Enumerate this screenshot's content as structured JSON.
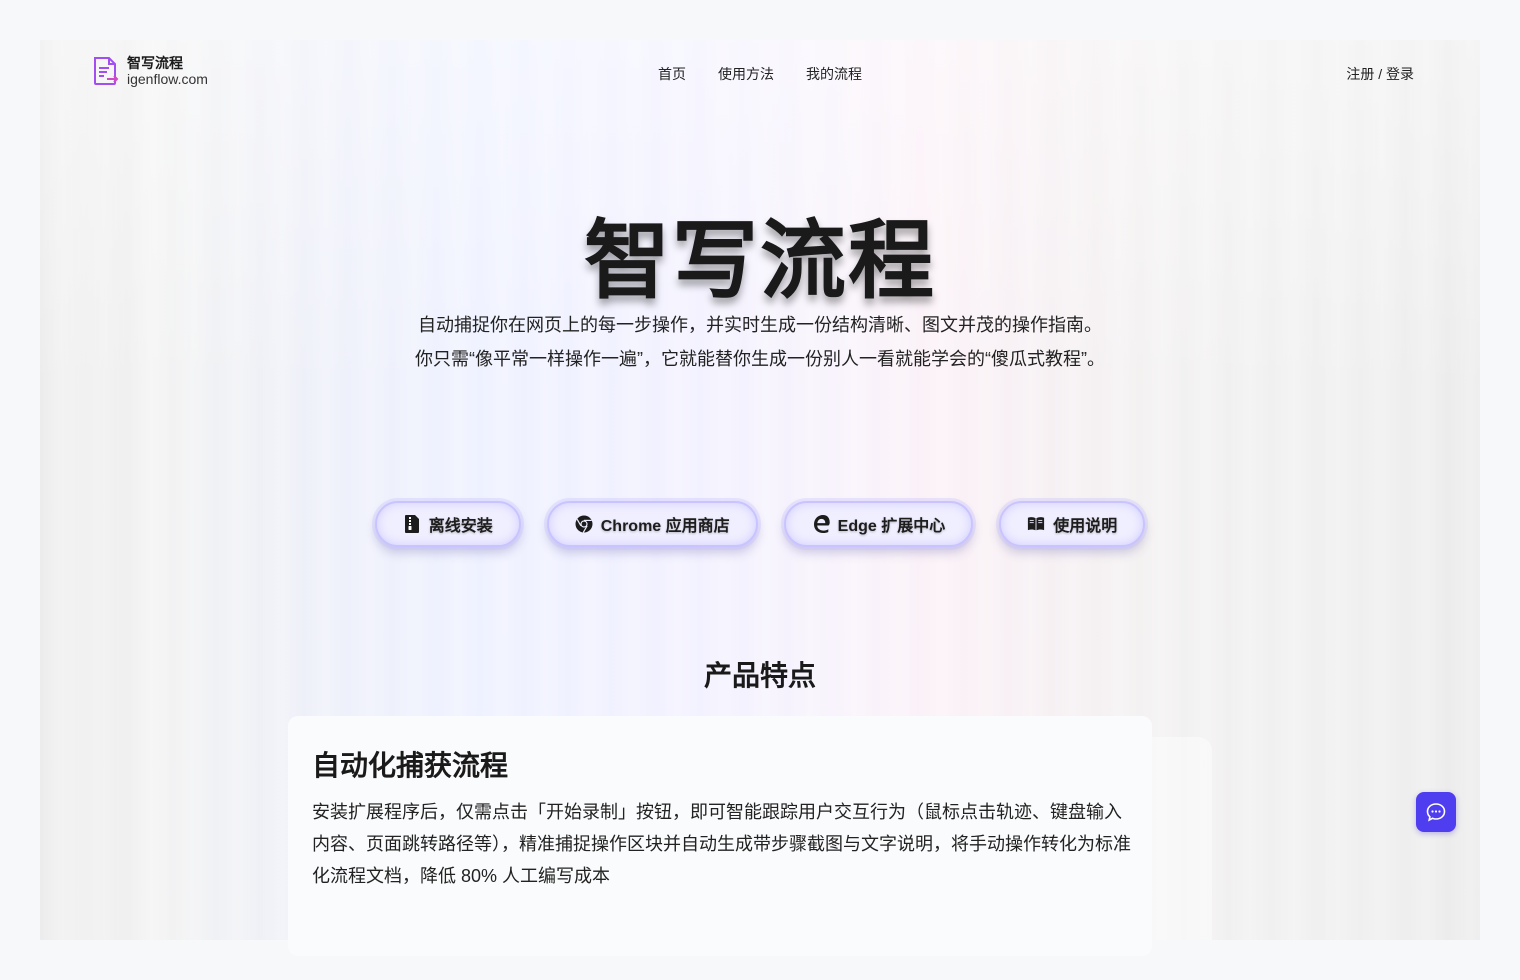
{
  "header": {
    "brand_name": "智写流程",
    "brand_domain": "igenflow.com",
    "nav": [
      "首页",
      "使用方法",
      "我的流程"
    ],
    "auth_label": "注册 / 登录"
  },
  "hero": {
    "title": "智写流程",
    "subtitle_line1": "自动捕捉你在网页上的每一步操作，并实时生成一份结构清晰、图文并茂的操作指南。",
    "subtitle_line2": "你只需“像平常一样操作一遍”，它就能替你生成一份别人一看就能学会的“傻瓜式教程”。"
  },
  "actions": [
    {
      "label": "离线安装",
      "icon": "zip-file-icon"
    },
    {
      "label": "Chrome 应用商店",
      "icon": "chrome-icon"
    },
    {
      "label": "Edge 扩展中心",
      "icon": "edge-icon"
    },
    {
      "label": "使用说明",
      "icon": "book-icon"
    }
  ],
  "features": {
    "section_title": "产品特点",
    "cards": [
      {
        "title": "自动化捕获流程",
        "description": "安装扩展程序后，仅需点击「开始录制」按钮，即可智能跟踪用户交互行为（鼠标点击轨迹、键盘输入内容、页面跳转路径等），精准捕捉操作区块并自动生成带步骤截图与文字说明，将手动操作转化为标准化流程文档，降低 80% 人工编写成本"
      }
    ]
  },
  "colors": {
    "accent": "#4f3df0",
    "button_border": "#c9c4ff",
    "logo_purple": "#a24ef0"
  },
  "chat": {
    "icon": "chat-icon"
  }
}
